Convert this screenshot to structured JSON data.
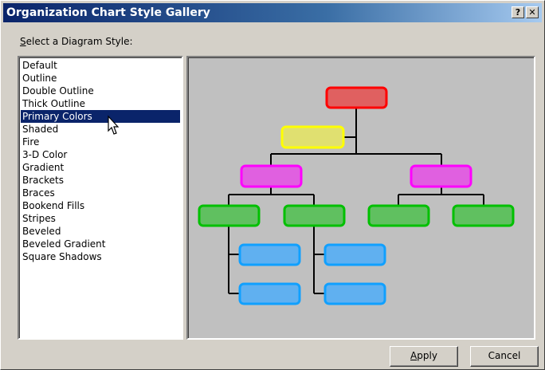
{
  "window": {
    "title": "Organization Chart Style Gallery",
    "help_label": "?",
    "close_label": "✕"
  },
  "prompt": {
    "accel": "S",
    "rest": "elect a Diagram Style:"
  },
  "styles": {
    "items": [
      "Default",
      "Outline",
      "Double Outline",
      "Thick Outline",
      "Primary Colors",
      "Shaded",
      "Fire",
      "3-D Color",
      "Gradient",
      "Brackets",
      "Braces",
      "Bookend Fills",
      "Stripes",
      "Beveled",
      "Beveled Gradient",
      "Square Shadows"
    ],
    "selected_index": 4
  },
  "buttons": {
    "apply_accel": "A",
    "apply_rest": "pply",
    "cancel": "Cancel"
  },
  "colors": {
    "red_fill": "#e06060",
    "red_stroke": "#ff0000",
    "yellow_fill": "#e0e070",
    "yellow_stroke": "#ffff00",
    "magenta_fill": "#e060e0",
    "magenta_stroke": "#ff00ff",
    "green_fill": "#60c060",
    "green_stroke": "#00c000",
    "blue_fill": "#60b0f0",
    "blue_stroke": "#10a0ff",
    "connector": "#000000"
  }
}
